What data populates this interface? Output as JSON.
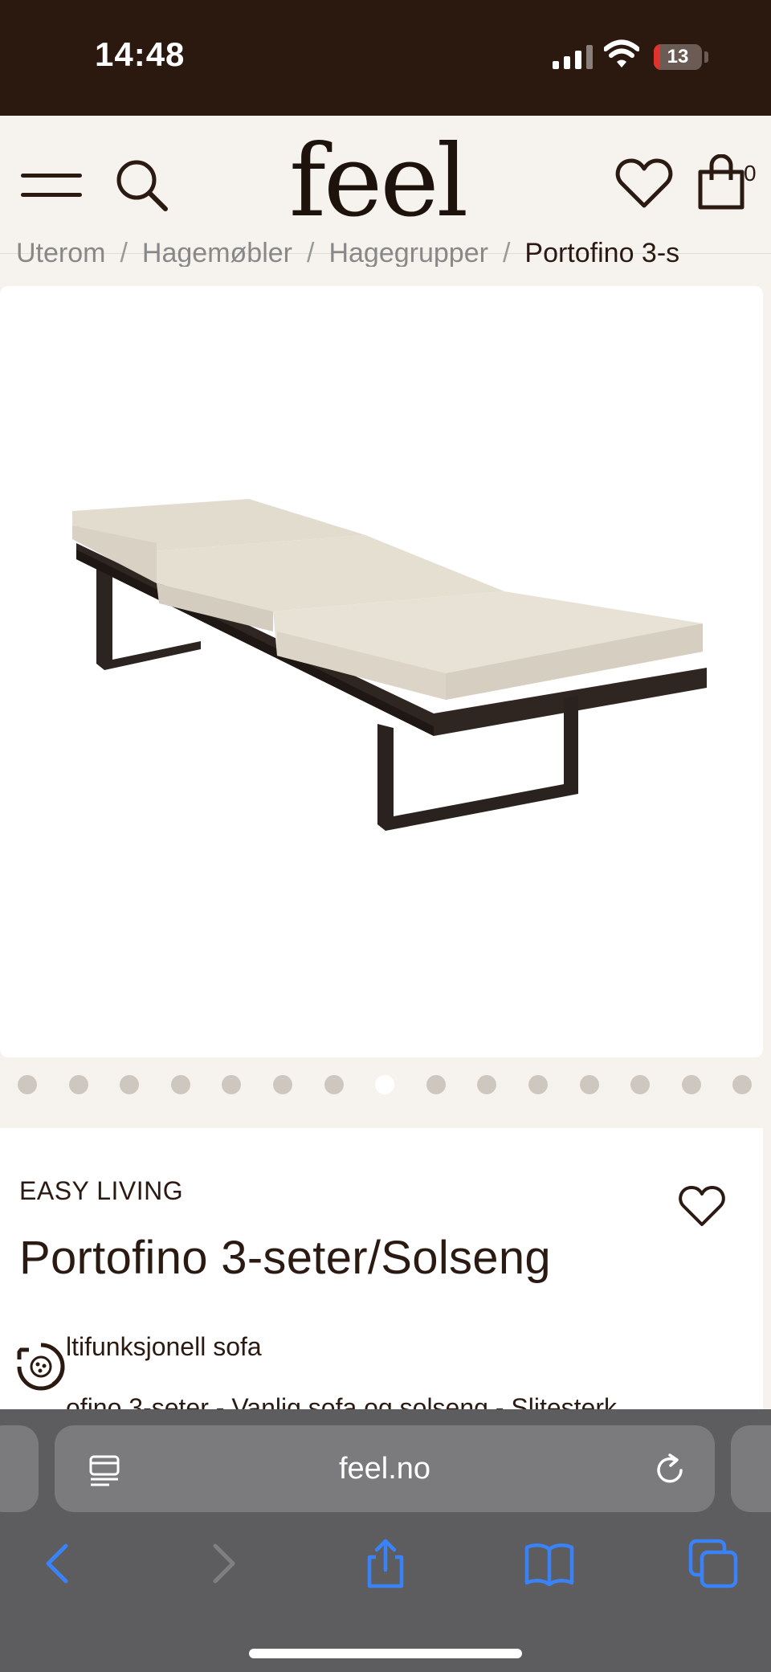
{
  "status_bar": {
    "time": "14:48",
    "battery_level": "13",
    "battery_fraction": 0.13
  },
  "header": {
    "logo": "feel",
    "cart_count": "0",
    "icons": [
      "menu-icon",
      "search-icon",
      "heart-icon",
      "shopping-bag-icon"
    ]
  },
  "breadcrumb": {
    "items": [
      "Uterom",
      "Hagemøbler",
      "Hagegrupper",
      "Portofino 3-s"
    ]
  },
  "gallery": {
    "dot_count": 15,
    "active_index": 7
  },
  "product": {
    "brand": "EASY LIVING",
    "title": "Portofino 3-seter/Solseng",
    "subtitle": "ltifunksjonell sofa",
    "description": "ofino 3-seter - Vanlig sofa og solseng - Slitesterk"
  },
  "browser": {
    "url": "feel.no",
    "icons": [
      "reader-icon",
      "reload-icon",
      "back-icon",
      "forward-icon",
      "share-icon",
      "bookmarks-icon",
      "tabs-icon"
    ]
  },
  "colors": {
    "status_bar_bg": "#2b190f",
    "page_bg": "#f6f3ee",
    "text": "#2a1a12",
    "browser_bg": "#5d5d60",
    "browser_accent": "#3a82f7"
  }
}
